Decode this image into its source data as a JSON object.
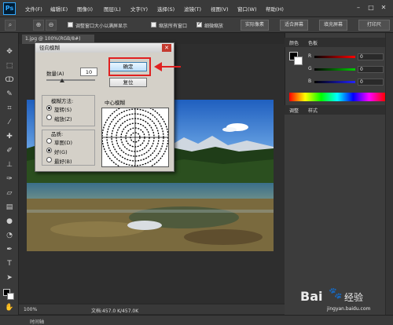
{
  "app": {
    "logo": "Ps",
    "menu": [
      "文件(F)",
      "编辑(E)",
      "图像(I)",
      "图层(L)",
      "文字(Y)",
      "选择(S)",
      "滤镜(T)",
      "视图(V)",
      "窗口(W)",
      "帮助(H)"
    ]
  },
  "options_bar": {
    "resize_windows_label": "调整窗口大小以满屏显示",
    "zoom_all_windows_label": "缩放所有窗口",
    "scrubby_zoom_label": "细微缩放",
    "actual_pixels": "实际像素",
    "fit_screen": "适合屏幕",
    "fill_screen": "填充屏幕",
    "print_size": "打印尺"
  },
  "document": {
    "tab": "1.jpg @ 100%(RGB/8#)",
    "zoom": "100%",
    "doc_size": "文档:457.0 K/457.0K"
  },
  "dialog": {
    "title": "径向模糊",
    "amount_label": "数量(A)",
    "amount_value": "10",
    "method_label": "模糊方法:",
    "method_options": [
      "旋转(S)",
      "缩放(Z)"
    ],
    "method_selected": "旋转(S)",
    "quality_label": "品质:",
    "quality_options": [
      "草图(D)",
      "好(G)",
      "最好(B)"
    ],
    "quality_selected": "好(G)",
    "ok": "确定",
    "cancel": "复位",
    "center_label": "中心模糊"
  },
  "right_panel": {
    "color_tabs": [
      "颜色",
      "色板"
    ],
    "channels": [
      {
        "label": "R",
        "value": "0",
        "color": "#d22"
      },
      {
        "label": "G",
        "value": "0",
        "color": "#2b2"
      },
      {
        "label": "B",
        "value": "0",
        "color": "#22d"
      }
    ],
    "adjust_tabs": [
      "调整",
      "样式"
    ]
  },
  "bottom": {
    "label": "时间轴"
  },
  "watermark": {
    "brand_a": "Bai",
    "brand_b": "经验",
    "url": "jingyan.baidu.com"
  },
  "colors": {
    "ui_dark": "#3a3a3a",
    "dialog_bg": "#d4d0c8",
    "highlight": "#e02020"
  }
}
